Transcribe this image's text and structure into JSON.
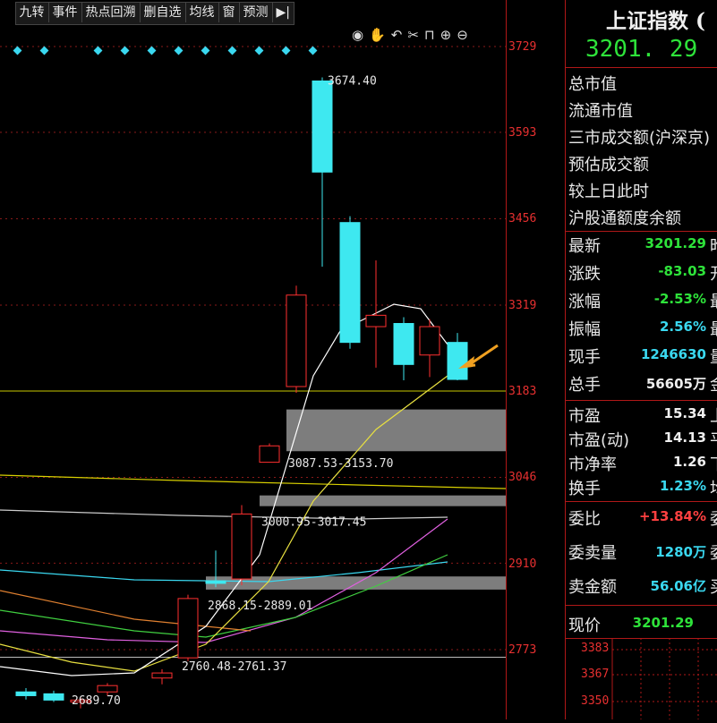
{
  "toolbar": {
    "items": [
      "九转",
      "事件",
      "热点回溯",
      "删自选",
      "均线",
      "窗",
      "预测",
      "▶|"
    ]
  },
  "chart_data": {
    "type": "candlestick",
    "y_axis_ticks": [
      "3729",
      "3593",
      "3456",
      "3319",
      "3183",
      "3046",
      "2910",
      "2773"
    ],
    "ylim": [
      2650,
      3750
    ],
    "candles": [
      {
        "o": 2700,
        "h": 2712,
        "l": 2694,
        "c": 2706,
        "color": "cyan"
      },
      {
        "o": 2703,
        "h": 2708,
        "l": 2690,
        "c": 2693,
        "color": "cyan"
      },
      {
        "o": 2690,
        "h": 2698,
        "l": 2680,
        "c": 2693,
        "color": "red"
      },
      {
        "o": 2706,
        "h": 2720,
        "l": 2700,
        "c": 2716,
        "color": "red"
      },
      {
        "o": 2728,
        "h": 2742,
        "l": 2718,
        "c": 2736,
        "color": "red"
      },
      {
        "o": 2760,
        "h": 2860,
        "l": 2755,
        "c": 2854,
        "color": "red"
      },
      {
        "o": 2878,
        "h": 2930,
        "l": 2872,
        "c": 2882,
        "color": "cyan"
      },
      {
        "o": 2885,
        "h": 3002,
        "l": 2875,
        "c": 2988,
        "color": "red"
      },
      {
        "o": 3070,
        "h": 3100,
        "l": 3072,
        "c": 3096,
        "color": "red"
      },
      {
        "o": 3190,
        "h": 3350,
        "l": 3180,
        "c": 3335,
        "color": "red"
      },
      {
        "o": 3674.4,
        "h": 3680,
        "l": 3380,
        "c": 3530,
        "color": "cyan"
      },
      {
        "o": 3450,
        "h": 3460,
        "l": 3250,
        "c": 3260,
        "color": "cyan"
      },
      {
        "o": 3285,
        "h": 3390,
        "l": 3220,
        "c": 3303,
        "color": "red"
      },
      {
        "o": 3290,
        "h": 3300,
        "l": 3200,
        "c": 3225,
        "color": "cyan"
      },
      {
        "o": 3240,
        "h": 3297,
        "l": 3205,
        "c": 3285,
        "color": "red"
      },
      {
        "o": 3260,
        "h": 3275,
        "l": 3200,
        "c": 3201.29,
        "color": "cyan"
      }
    ],
    "annotations": [
      "3674.40",
      "3087.53-3153.70",
      "3000.95-3017.45",
      "2868.15-2889.01",
      "2760.48-2761.37",
      "2689.70"
    ],
    "gap_zones": [
      {
        "low": 3087.53,
        "high": 3153.7,
        "label": "3087.53-3153.70"
      },
      {
        "low": 3000.95,
        "high": 3017.45,
        "label": "3000.95-3017.45"
      },
      {
        "low": 2868.15,
        "high": 2889.01,
        "label": "2868.15-2889.01"
      }
    ],
    "grid": true
  },
  "panel": {
    "title": "上证指数 (",
    "price": "3201. 29",
    "info_labels": [
      "总市值",
      "流通市值",
      "三市成交额(沪深京)",
      "预估成交额",
      "较上日此时",
      "沪股通额度余额"
    ],
    "quote": [
      {
        "k": "最新",
        "v": "3201.29",
        "color": "#2ee33a",
        "t": "昨"
      },
      {
        "k": "涨跌",
        "v": "-83.03",
        "color": "#2ee33a",
        "t": "开"
      },
      {
        "k": "涨幅",
        "v": "-2.53%",
        "color": "#2ee33a",
        "t": "最"
      },
      {
        "k": "振幅",
        "v": "2.56%",
        "color": "#3ad8f0",
        "t": "最"
      },
      {
        "k": "现手",
        "v": "1246630",
        "color": "#3ad8f0",
        "t": "量"
      },
      {
        "k": "总手",
        "v": "56605万",
        "color": "#f0f0f0",
        "t": "金"
      }
    ],
    "valuation": [
      {
        "k": "市盈",
        "v": "15.34",
        "color": "#f0f0f0",
        "t": "上"
      },
      {
        "k": "市盈(动)",
        "v": "14.13",
        "color": "#f0f0f0",
        "t": "平"
      },
      {
        "k": "市净率",
        "v": "1.26",
        "color": "#f0f0f0",
        "t": "下"
      },
      {
        "k": "换手",
        "v": "1.23%",
        "color": "#3ad8f0",
        "t": "均"
      }
    ],
    "order": [
      {
        "k": "委比",
        "v": "+13.84%",
        "color": "#ff4040",
        "t": "委"
      },
      {
        "k": "委卖量",
        "v": "1280万",
        "color": "#3ad8f0",
        "t": "委"
      },
      {
        "k": "卖金额",
        "v": "56.06亿",
        "color": "#3ad8f0",
        "t": "买"
      }
    ],
    "current_price": {
      "k": "现价",
      "v": "3201.29",
      "color": "#2ee33a"
    },
    "mini_ticks": [
      "3383",
      "3367",
      "3350"
    ]
  }
}
